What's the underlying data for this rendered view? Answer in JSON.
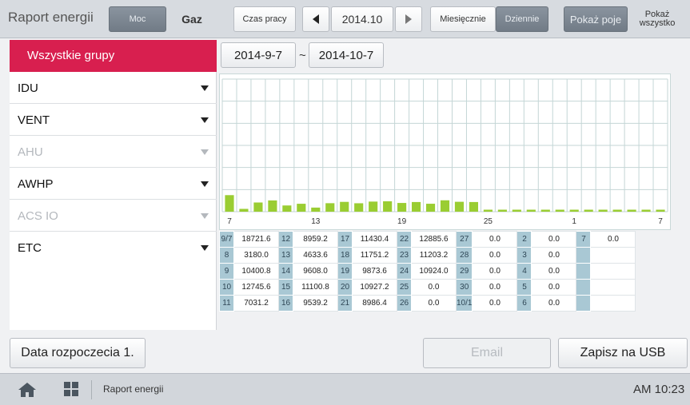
{
  "header": {
    "title": "Raport energii",
    "tab_power": "Moc",
    "tab_gas": "Gaz",
    "tab_runtime": "Czas pracy",
    "period": "2014.10",
    "mode_monthly": "Miesięcznie",
    "mode_daily": "Dziennie",
    "show_energy": "Pokaż poje",
    "show_all_line1": "Pokaż",
    "show_all_line2": "wszystko"
  },
  "sidebar": {
    "all_groups": "Wszystkie grupy",
    "groups": [
      {
        "label": "IDU",
        "enabled": true
      },
      {
        "label": "VENT",
        "enabled": true
      },
      {
        "label": "AHU",
        "enabled": false
      },
      {
        "label": "AWHP",
        "enabled": true
      },
      {
        "label": "ACS IO",
        "enabled": false
      },
      {
        "label": "ETC",
        "enabled": true
      }
    ]
  },
  "date_range": {
    "start": "2014-9-7",
    "separator": "~",
    "end": "2014-10-7"
  },
  "chart_data": {
    "type": "bar",
    "categories": [
      "9/7",
      "8",
      "9",
      "10",
      "11",
      "12",
      "13",
      "14",
      "15",
      "16",
      "17",
      "18",
      "19",
      "20",
      "21",
      "22",
      "23",
      "24",
      "25",
      "26",
      "27",
      "28",
      "29",
      "30",
      "10/1",
      "2",
      "3",
      "4",
      "5",
      "6",
      "7"
    ],
    "values": [
      18721.6,
      3180.0,
      10400.8,
      12745.6,
      7031.2,
      8959.2,
      4633.6,
      9608.0,
      11100.8,
      9539.2,
      11430.4,
      11751.2,
      9873.6,
      10927.2,
      8986.4,
      12885.6,
      11203.2,
      10924.0,
      0.0,
      0.0,
      0.0,
      0.0,
      0.0,
      0.0,
      0.0,
      0.0,
      0.0,
      0.0,
      0.0,
      0.0,
      0.0
    ],
    "x_tick_labels": [
      "7",
      "13",
      "19",
      "25",
      "1",
      "7"
    ],
    "bar_color": "#9acd32",
    "grid": true
  },
  "table": {
    "columns": [
      [
        [
          "9/7",
          "18721.6"
        ],
        [
          "8",
          "3180.0"
        ],
        [
          "9",
          "10400.8"
        ],
        [
          "10",
          "12745.6"
        ],
        [
          "11",
          "7031.2"
        ]
      ],
      [
        [
          "12",
          "8959.2"
        ],
        [
          "13",
          "4633.6"
        ],
        [
          "14",
          "9608.0"
        ],
        [
          "15",
          "11100.8"
        ],
        [
          "16",
          "9539.2"
        ]
      ],
      [
        [
          "17",
          "11430.4"
        ],
        [
          "18",
          "11751.2"
        ],
        [
          "19",
          "9873.6"
        ],
        [
          "20",
          "10927.2"
        ],
        [
          "21",
          "8986.4"
        ]
      ],
      [
        [
          "22",
          "12885.6"
        ],
        [
          "23",
          "11203.2"
        ],
        [
          "24",
          "10924.0"
        ],
        [
          "25",
          "0.0"
        ],
        [
          "26",
          "0.0"
        ]
      ],
      [
        [
          "27",
          "0.0"
        ],
        [
          "28",
          "0.0"
        ],
        [
          "29",
          "0.0"
        ],
        [
          "30",
          "0.0"
        ],
        [
          "10/1",
          "0.0"
        ]
      ],
      [
        [
          "2",
          "0.0"
        ],
        [
          "3",
          "0.0"
        ],
        [
          "4",
          "0.0"
        ],
        [
          "5",
          "0.0"
        ],
        [
          "6",
          "0.0"
        ]
      ],
      [
        [
          "7",
          "0.0"
        ],
        [
          "",
          ""
        ],
        [
          "",
          ""
        ],
        [
          "",
          ""
        ],
        [
          "",
          ""
        ]
      ]
    ]
  },
  "buttons": {
    "start_date": "Data rozpoczecia 1.",
    "email": "Email",
    "save_usb": "Zapisz na USB"
  },
  "footer": {
    "title": "Raport energii",
    "time": "AM 10:23"
  },
  "colors": {
    "accent": "#d81f4f",
    "bar": "#9acd32",
    "day_cell": "#a9c8d4",
    "selected_tab": "#7e8893"
  }
}
